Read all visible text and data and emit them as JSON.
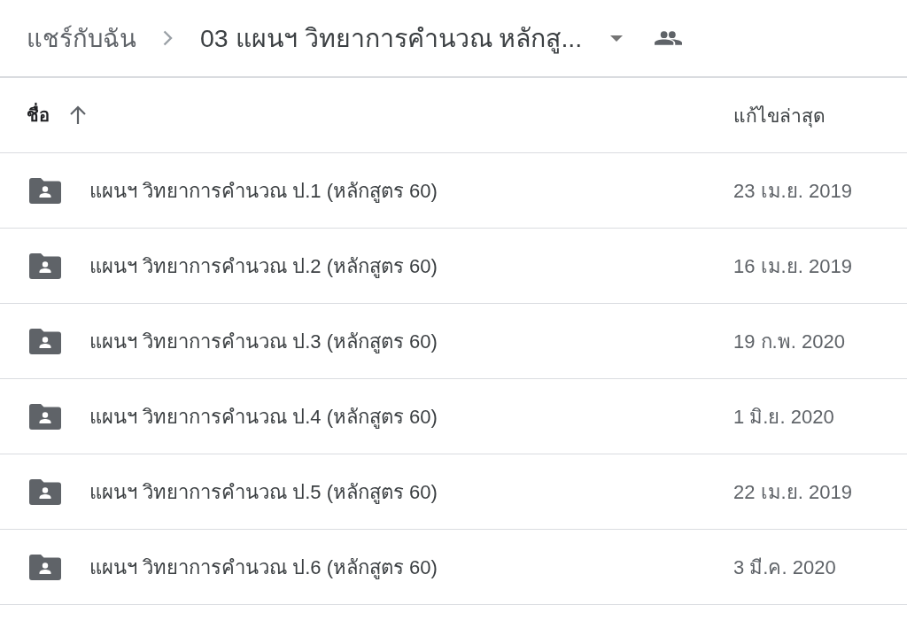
{
  "breadcrumb": [
    {
      "label": "แชร์กับฉัน",
      "current": false
    },
    {
      "label": "03 แผนฯ วิทยาการคำนวณ หลักสู...",
      "current": true
    }
  ],
  "columns": [
    {
      "label": "ชื่อ",
      "sorted": true,
      "ascending": true
    },
    {
      "label": "แก้ไขล่าสุด",
      "sorted": false
    }
  ],
  "rows": [
    {
      "name": "แผนฯ วิทยาการคำนวณ ป.1 (หลักสูตร 60)",
      "modified": "23 เม.ย. 2019"
    },
    {
      "name": "แผนฯ วิทยาการคำนวณ ป.2 (หลักสูตร 60)",
      "modified": "16 เม.ย. 2019"
    },
    {
      "name": "แผนฯ วิทยาการคำนวณ ป.3 (หลักสูตร 60)",
      "modified": "19 ก.พ. 2020"
    },
    {
      "name": "แผนฯ วิทยาการคำนวณ ป.4 (หลักสูตร 60)",
      "modified": "1 มิ.ย. 2020"
    },
    {
      "name": "แผนฯ วิทยาการคำนวณ ป.5 (หลักสูตร 60)",
      "modified": "22 เม.ย. 2019"
    },
    {
      "name": "แผนฯ วิทยาการคำนวณ ป.6 (หลักสูตร 60)",
      "modified": "3 มี.ค. 2020"
    }
  ]
}
